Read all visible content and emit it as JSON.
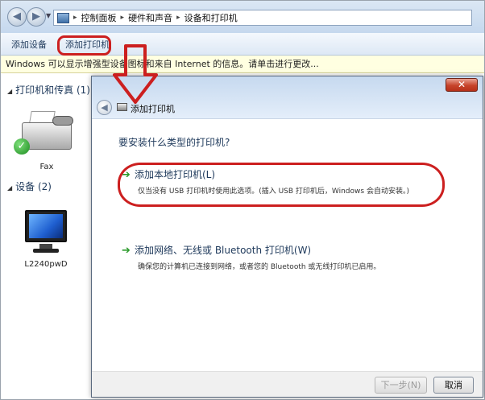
{
  "window": {
    "nav_back_glyph": "◀",
    "nav_forward_glyph": "▶",
    "breadcrumb": [
      "控制面板",
      "硬件和声音",
      "设备和打印机"
    ],
    "breadcrumb_sep": "▸"
  },
  "toolbar": {
    "add_device_label": "添加设备",
    "add_printer_label": "添加打印机"
  },
  "infobar": {
    "text": "Windows 可以显示增强型设备图标和来自 Internet 的信息。请单击进行更改..."
  },
  "groups": {
    "printers": {
      "label": "打印机和传真 (1)",
      "devices": [
        {
          "name": "Fax",
          "icon": "fax-icon",
          "status_icon": "check-icon"
        }
      ]
    },
    "devices": {
      "label": "设备 (2)",
      "devices": [
        {
          "name": "L2240pwD",
          "icon": "monitor-icon"
        }
      ]
    }
  },
  "dialog": {
    "title": "添加打印机",
    "close_glyph": "✕",
    "question": "要安装什么类型的打印机?",
    "options": [
      {
        "title": "添加本地打印机(L)",
        "description": "仅当没有 USB 打印机时使用此选项。(插入 USB 打印机后，Windows 会自动安装。)"
      },
      {
        "title": "添加网络、无线或 Bluetooth 打印机(W)",
        "description": "确保您的计算机已连接到网络，或者您的 Bluetooth 或无线打印机已启用。"
      }
    ],
    "next_label": "下一步(N)",
    "cancel_label": "取消"
  },
  "annotation_colors": {
    "highlight": "#cc1f1f"
  }
}
